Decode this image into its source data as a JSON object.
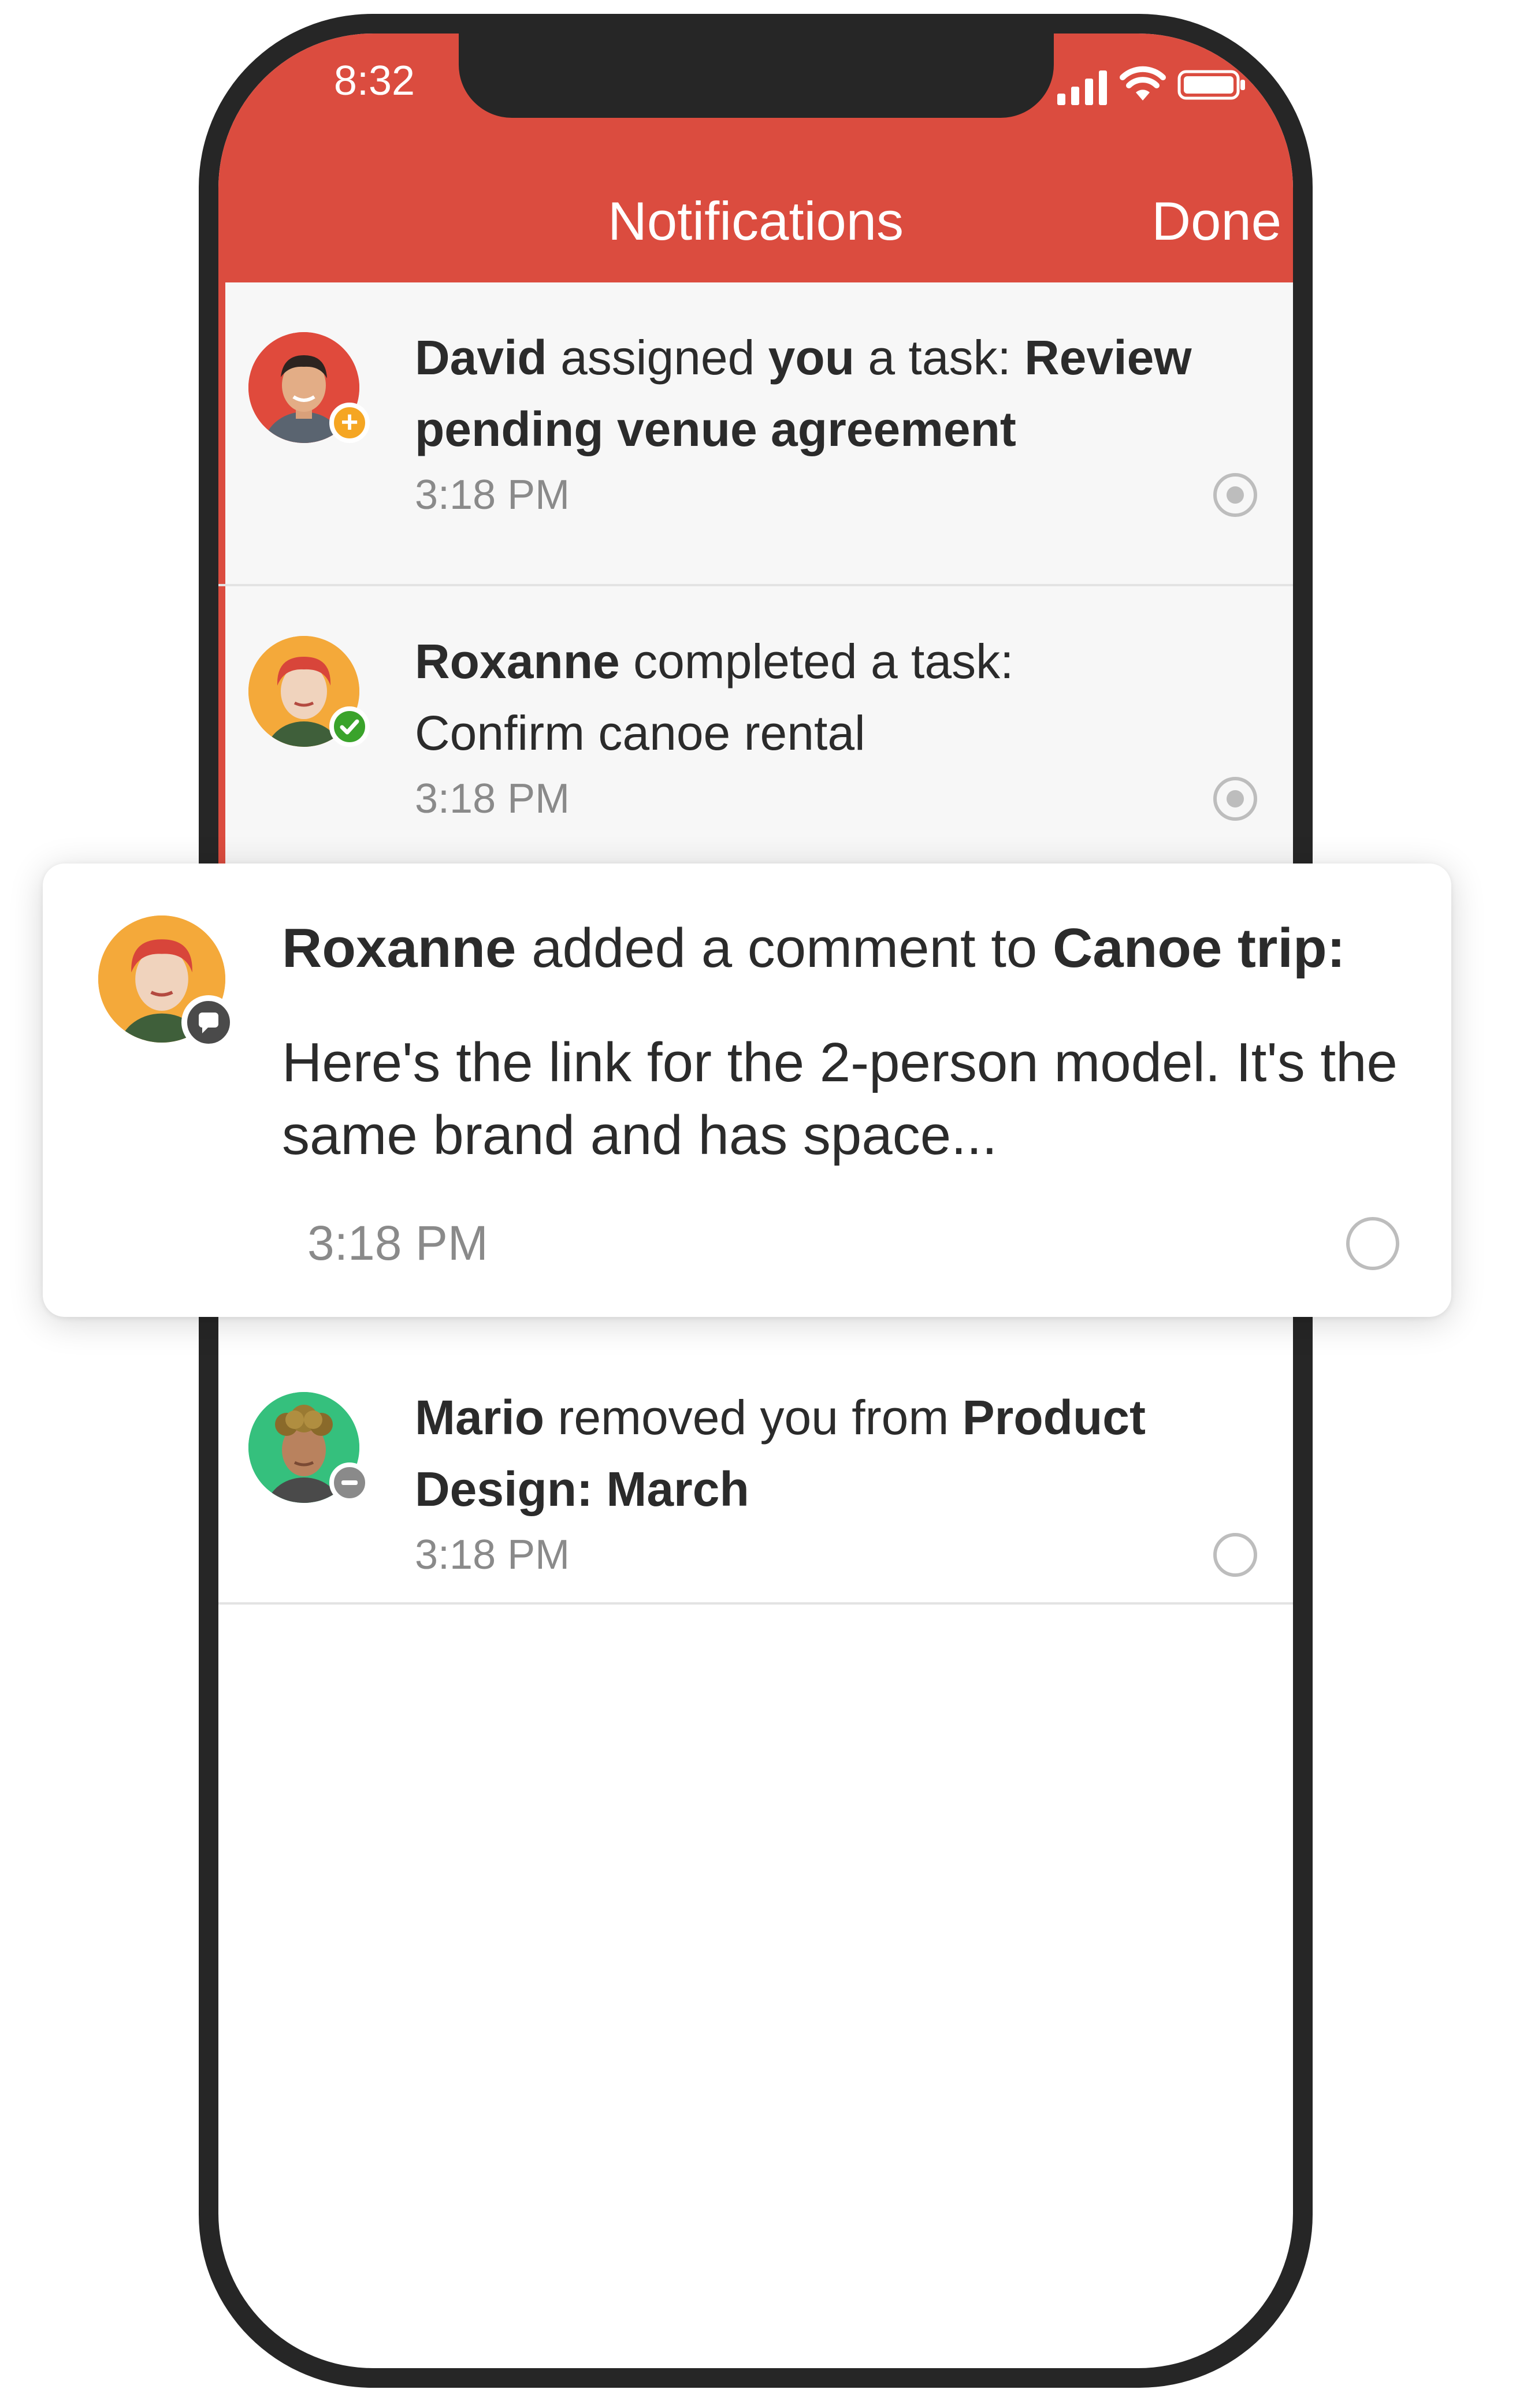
{
  "status_bar": {
    "time": "8:32",
    "signal_icon": "cellular-signal-icon",
    "wifi_icon": "wifi-icon",
    "battery_icon": "battery-icon"
  },
  "header": {
    "title": "Notifications",
    "done_label": "Done",
    "color": "#db4c3f"
  },
  "notifications": [
    {
      "actor": "David",
      "text_1": " assigned ",
      "you": "you",
      "text_2": " a task: ",
      "target": "Review pending venue agreement",
      "time": "3:18 PM",
      "badge_icon": "plus-icon",
      "badge_color": "#f5a623",
      "read_state": "read"
    },
    {
      "actor": "Roxanne",
      "text_1": " completed a task:",
      "detail": "Confirm canoe rental",
      "time": "3:18 PM",
      "badge_icon": "check-icon",
      "badge_color": "#3aa32b",
      "read_state": "read"
    },
    {
      "actor": "Roxanne",
      "text_1": " added a comment to ",
      "target": "Canoe trip:",
      "comment": "Here's the link for the 2-person model. It's the same brand and has space...",
      "time": "3:18 PM",
      "badge_icon": "comment-icon",
      "badge_color": "#4a4a4a",
      "read_state": "unread"
    },
    {
      "actor": "Mario",
      "text_1": " removed you from ",
      "target": "Product Design: March",
      "time": "3:18 PM",
      "badge_icon": "minus-icon",
      "badge_color": "#8a8a8a",
      "read_state": "unread"
    }
  ]
}
